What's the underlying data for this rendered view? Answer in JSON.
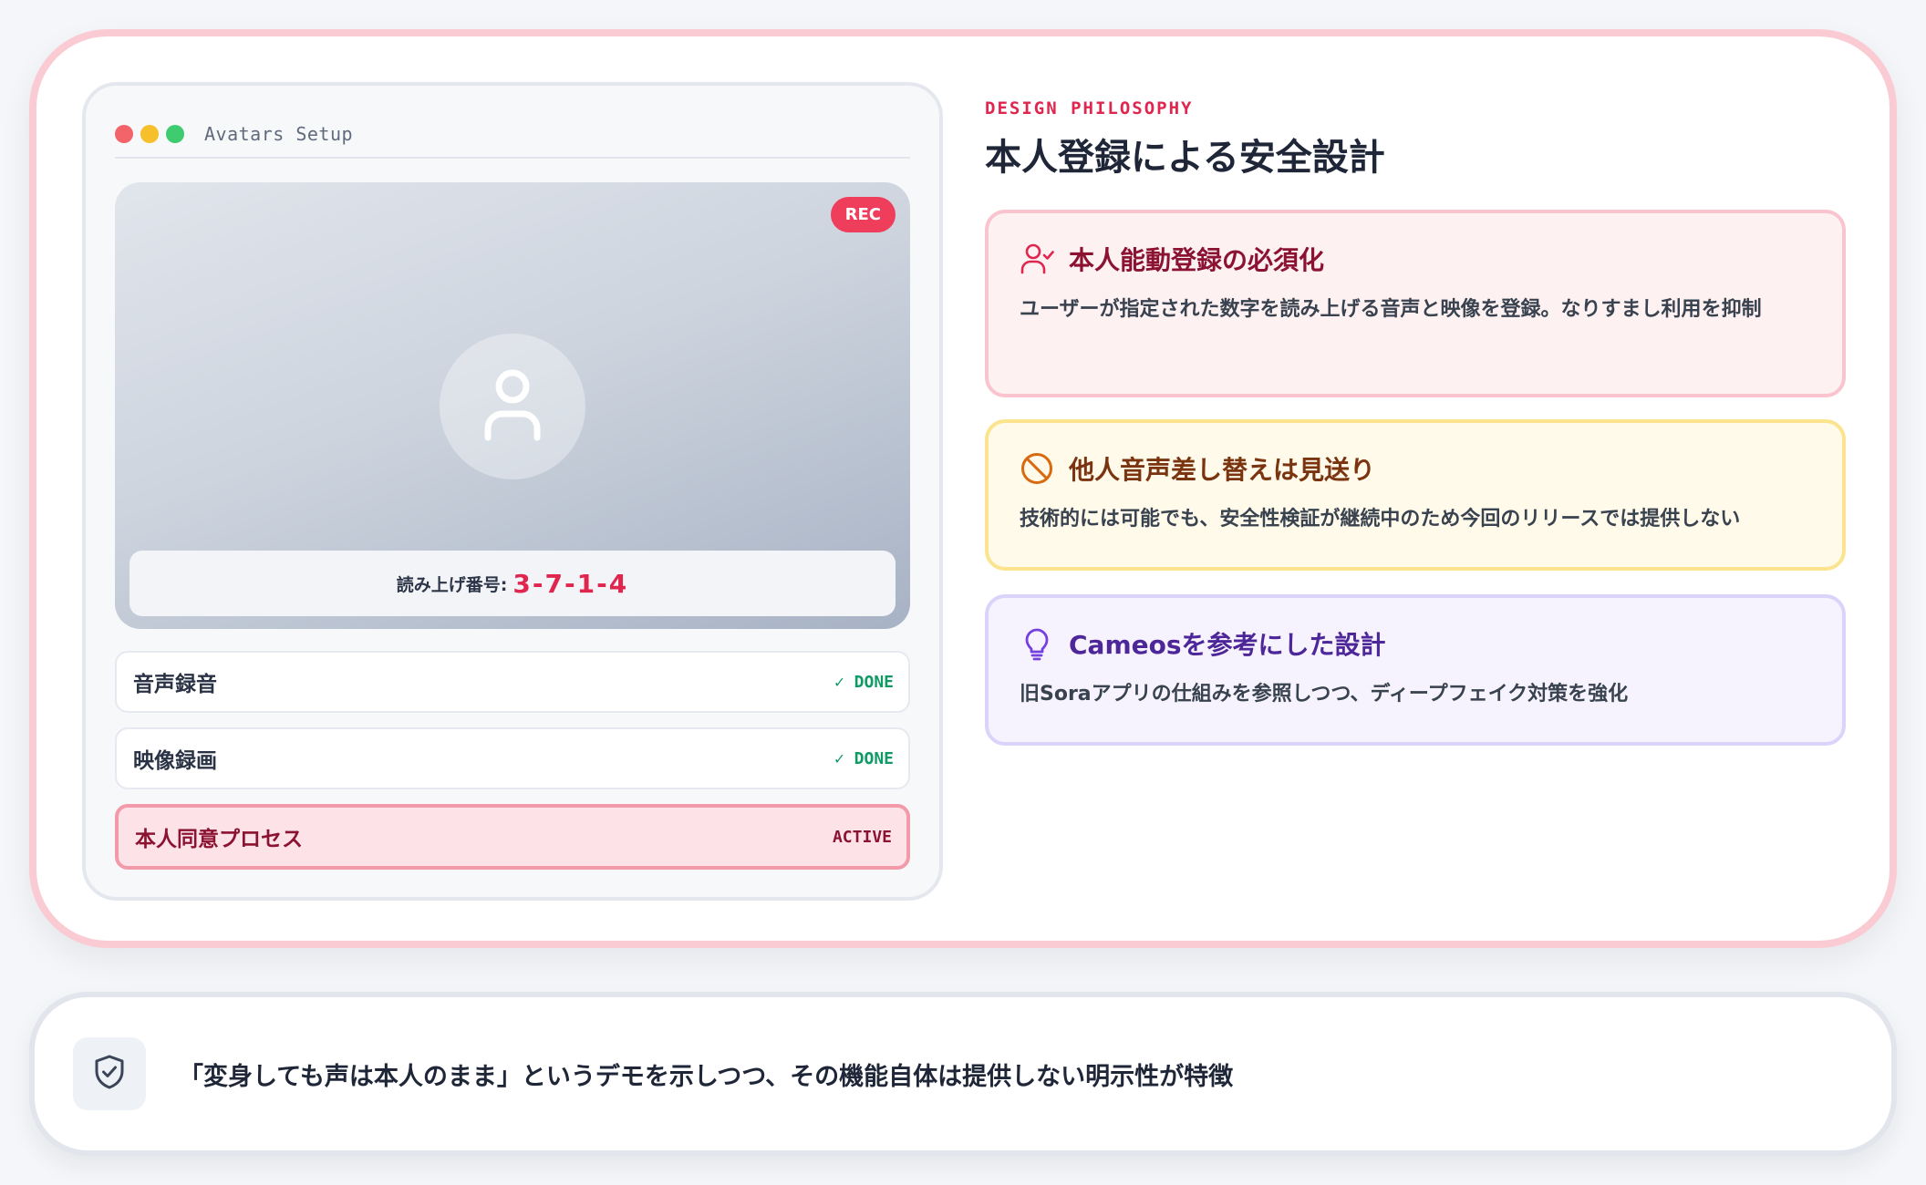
{
  "setup_window": {
    "title": "Avatars Setup",
    "rec_label": "REC",
    "avatar_icon": "user-icon",
    "read_label": "読み上げ番号:",
    "read_number": "3-7-1-4",
    "steps": [
      {
        "label": "音声録音",
        "status": "✓ DONE"
      },
      {
        "label": "映像録画",
        "status": "✓ DONE"
      },
      {
        "label": "本人同意プロセス",
        "status": "ACTIVE"
      }
    ]
  },
  "philosophy": {
    "eyebrow": "DESIGN PHILOSOPHY",
    "heading": "本人登録による安全設計",
    "features": [
      {
        "icon": "user-check-icon",
        "title": "本人能動登録の必須化",
        "description": "ユーザーが指定された数字を読み上げる音声と映像を登録。なりすまし利用を抑制",
        "accent": "#e0264f"
      },
      {
        "icon": "ban-icon",
        "title": "他人音声差し替えは見送り",
        "description": "技術的には可能でも、安全性検証が継続中のため今回のリリースでは提供しない",
        "accent": "#d9690e"
      },
      {
        "icon": "lightbulb-icon",
        "title": "Cameosを参考にした設計",
        "description": "旧Soraアプリの仕組みを参照しつつ、ディープフェイク対策を強化",
        "accent": "#7440e0"
      }
    ]
  },
  "note": {
    "icon": "shield-check-icon",
    "text": "「変身しても声は本人のまま」というデモを示しつつ、その機能自体は提供しない明示性が特徴"
  }
}
